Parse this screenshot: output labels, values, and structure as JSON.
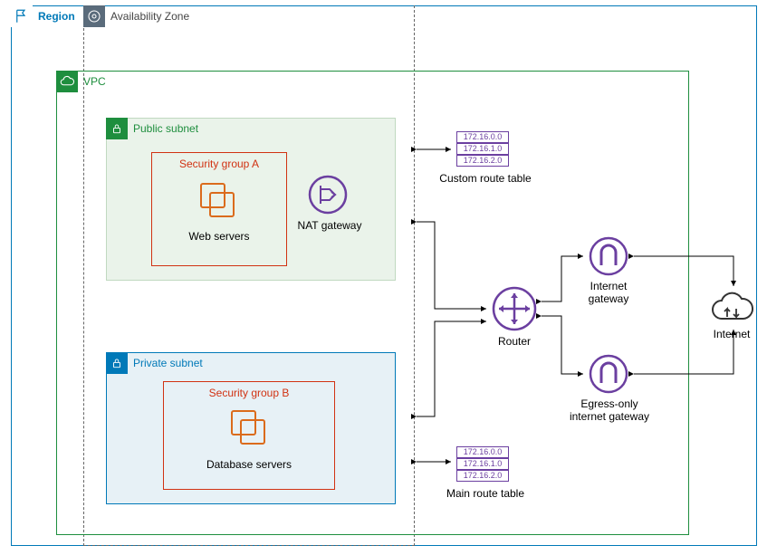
{
  "region": {
    "label": "Region"
  },
  "availability_zone": {
    "label": "Availability Zone"
  },
  "vpc": {
    "label": "VPC"
  },
  "public_subnet": {
    "label": "Public subnet",
    "security_group": {
      "label": "Security group A",
      "resource_label": "Web servers"
    },
    "nat_gateway": {
      "label": "NAT gateway"
    }
  },
  "private_subnet": {
    "label": "Private subnet",
    "security_group": {
      "label": "Security group B",
      "resource_label": "Database servers"
    }
  },
  "custom_route_table": {
    "label": "Custom route table",
    "entries": [
      "172.16.0.0",
      "172.16.1.0",
      "172.16.2.0"
    ]
  },
  "main_route_table": {
    "label": "Main route table",
    "entries": [
      "172.16.0.0",
      "172.16.1.0",
      "172.16.2.0"
    ]
  },
  "router": {
    "label": "Router"
  },
  "internet_gateway": {
    "label": "Internet gateway"
  },
  "egress_only_gateway": {
    "label": "Egress-only internet gateway"
  },
  "internet": {
    "label": "Internet"
  }
}
